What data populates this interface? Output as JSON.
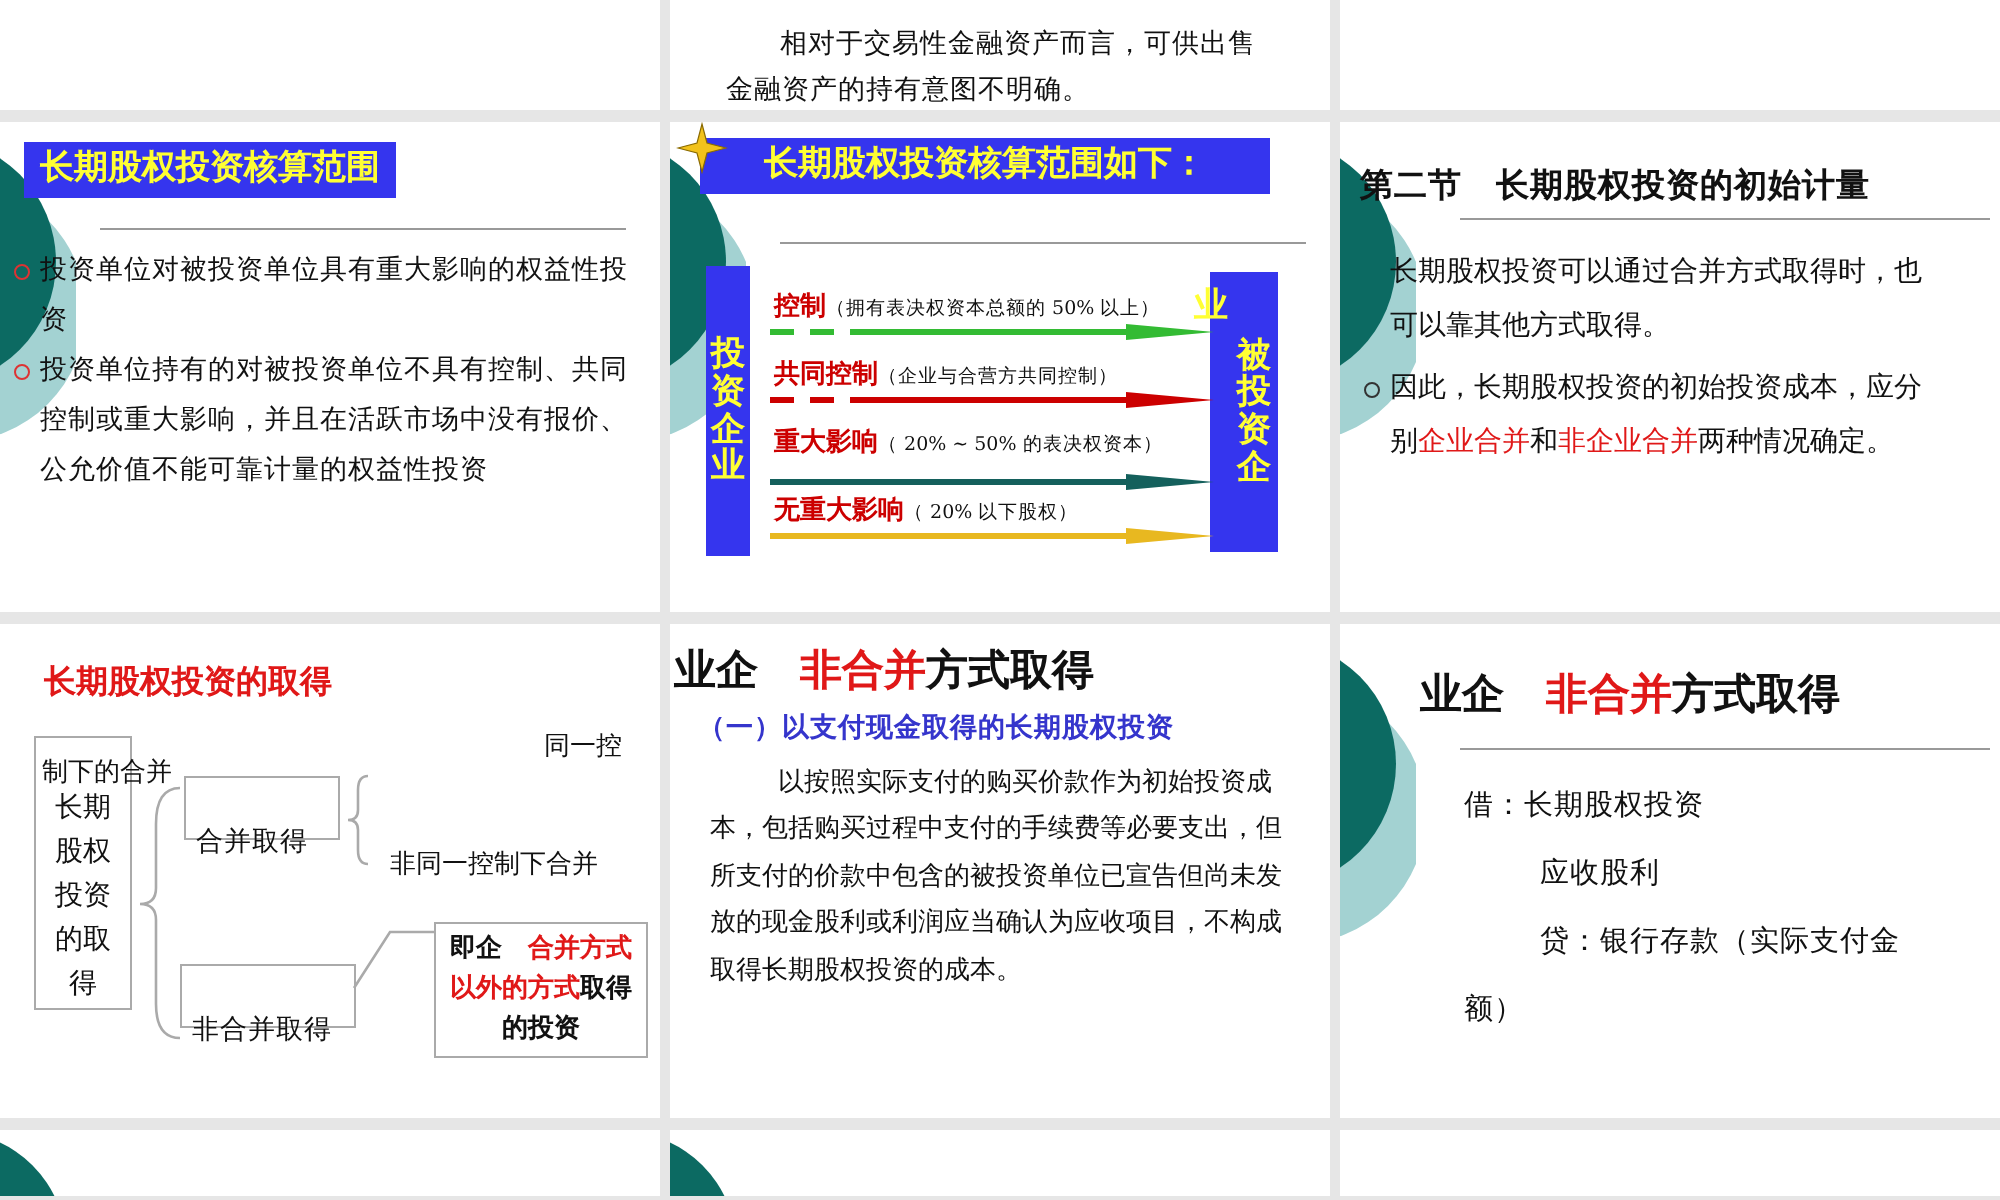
{
  "slides": [
    {
      "kind": "blank",
      "decor": false
    },
    {
      "kind": "note",
      "decor": false,
      "paragraph": "相对于交易性金融资产而言，可供出售金融资产的持有意图不明确。"
    },
    {
      "kind": "blank",
      "decor": false
    },
    {
      "kind": "bullets",
      "decor": true,
      "title": "长期股权投资核算范围",
      "items": [
        "投资单位对被投资单位具有重大影响的权益性投资",
        "投资单位持有的对被投资单位不具有控制、共同控制或重大影响，并且在活跃市场中没有报价、公允价值不能可靠计量的权益性投资"
      ]
    },
    {
      "kind": "arrows",
      "decor": true,
      "title": "长期股权投资核算范围如下：",
      "left_box": "投资企业",
      "right_box": "被投资企",
      "right_extra": "业",
      "rows": [
        {
          "term": "控制",
          "note": "（拥有表决权资本总额的 50% 以上）",
          "color": "#33bb33",
          "dashed": true
        },
        {
          "term": "共同控制",
          "note": "（企业与合营方共同控制）",
          "color": "#cc0000",
          "dashed": true
        },
        {
          "term": "重大影响",
          "note": "（ 20% ~ 50% 的表决权资本）",
          "color": "#14605c",
          "dashed": false
        },
        {
          "term": "无重大影响",
          "note": "（ 20% 以下股权）",
          "color": "#e8b820",
          "dashed": false
        }
      ]
    },
    {
      "kind": "section",
      "decor": true,
      "title": "第二节　长期股权投资的初始计量",
      "paragraphs": [
        {
          "bullet": false,
          "parts": [
            {
              "text": "长期股权投资可以通过合并方式取得时，也可以靠其他方式取得。",
              "red": false
            }
          ]
        },
        {
          "bullet": true,
          "parts": [
            {
              "text": "因此，长期股权投资的初始投资成本，应分别",
              "red": false
            },
            {
              "text": "企业合并",
              "red": true
            },
            {
              "text": "和",
              "red": false
            },
            {
              "text": "非企业合并",
              "red": true
            },
            {
              "text": "两种情况确定。",
              "red": false
            }
          ]
        }
      ]
    },
    {
      "kind": "tree",
      "decor": false,
      "title": [
        {
          "text": "长期股权投资的取得",
          "red": true
        }
      ],
      "root": "长期股权投资的取得",
      "root_overlay": "制下的合并",
      "top_label": "同一控",
      "branches": [
        "合并取得",
        "非合并取得"
      ],
      "side_label": "非同一控制下合并",
      "result": [
        {
          "text": "即企　",
          "red": false
        },
        {
          "text": "合并方式以外的方式",
          "red": true
        },
        {
          "text": "取得的投资",
          "red": false
        }
      ]
    },
    {
      "kind": "heading",
      "decor": false,
      "title": [
        {
          "text": "业企　",
          "red": false
        },
        {
          "text": "非合并",
          "red": true
        },
        {
          "text": "方式取得",
          "red": false
        }
      ],
      "subtitle": "（一）以支付现金取得的长期股权投资",
      "paragraph": "以按照实际支付的购买价款作为初始投资成本，包括购买过程中支付的手续费等必要支出，但所支付的价款中包含的被投资单位已宣告但尚未发放的现金股利或利润应当确认为应收项目，不构成取得长期股权投资的成本。"
    },
    {
      "kind": "entries",
      "decor": true,
      "title": [
        {
          "text": "业企　",
          "red": false
        },
        {
          "text": "非合并",
          "red": true
        },
        {
          "text": "方式取得",
          "red": false
        }
      ],
      "lines": [
        {
          "text": "借：长期股权投资",
          "indent": false
        },
        {
          "text": "应收股利",
          "indent": true
        },
        {
          "text": "贷：银行存款（实际支付金额）",
          "indent": true
        }
      ]
    },
    {
      "kind": "blank",
      "decor": true
    },
    {
      "kind": "blank",
      "decor": true
    },
    {
      "kind": "blank",
      "decor": false
    }
  ]
}
